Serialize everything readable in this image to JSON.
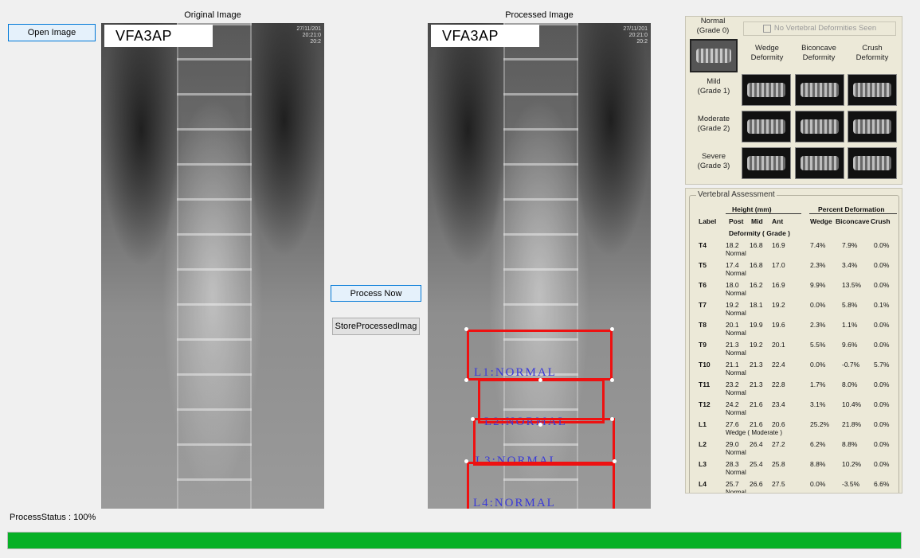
{
  "original": {
    "caption": "Original Image",
    "label": "VFA3AP",
    "stamp": "27/11/201\n20:21:0\n20:2"
  },
  "processed": {
    "caption": "Processed Image",
    "label": "VFA3AP",
    "stamp": "27/11/201\n20:21:0\n20:2",
    "boxes": [
      {
        "label": "L1:NORMAL"
      },
      {
        "label": "L2:NORMAL"
      },
      {
        "label": "L3:NORMAL"
      },
      {
        "label": "L4:NORMAL"
      }
    ]
  },
  "buttons": {
    "open": "Open Image",
    "process": "Process Now",
    "store": "StoreProcessedImag"
  },
  "reference": {
    "normal_label": "Normal\n(Grade 0)",
    "no_deformities": "No Vertebral Deformities Seen",
    "col_wedge": "Wedge\nDeformity",
    "col_biconcave": "Biconcave\nDeformity",
    "col_crush": "Crush\nDeformity",
    "row_mild": "Mild\n(Grade 1)",
    "row_moderate": "Moderate\n(Grade 2)",
    "row_severe": "Severe\n(Grade 3)"
  },
  "assessment": {
    "title": "Vertebral Assessment",
    "height_header": "Height (mm)",
    "percent_header": "Percent Deformation",
    "col_label": "Label",
    "col_post": "Post",
    "col_mid": "Mid",
    "col_ant": "Ant",
    "col_wedge": "Wedge",
    "col_biconcave": "Biconcave",
    "col_crush": "Crush",
    "deformity_header": "Deformity ( Grade )",
    "rows": [
      {
        "label": "T4",
        "post": "18.2",
        "mid": "16.8",
        "ant": "16.9",
        "wedge": "7.4%",
        "biconcave": "7.9%",
        "crush": "0.0%",
        "grade": "Normal"
      },
      {
        "label": "T5",
        "post": "17.4",
        "mid": "16.8",
        "ant": "17.0",
        "wedge": "2.3%",
        "biconcave": "3.4%",
        "crush": "0.0%",
        "grade": "Normal"
      },
      {
        "label": "T6",
        "post": "18.0",
        "mid": "16.2",
        "ant": "16.9",
        "wedge": "9.9%",
        "biconcave": "13.5%",
        "crush": "0.0%",
        "grade": "Normal"
      },
      {
        "label": "T7",
        "post": "19.2",
        "mid": "18.1",
        "ant": "19.2",
        "wedge": "0.0%",
        "biconcave": "5.8%",
        "crush": "0.1%",
        "grade": "Normal"
      },
      {
        "label": "T8",
        "post": "20.1",
        "mid": "19.9",
        "ant": "19.6",
        "wedge": "2.3%",
        "biconcave": "1.1%",
        "crush": "0.0%",
        "grade": "Normal"
      },
      {
        "label": "T9",
        "post": "21.3",
        "mid": "19.2",
        "ant": "20.1",
        "wedge": "5.5%",
        "biconcave": "9.6%",
        "crush": "0.0%",
        "grade": "Normal"
      },
      {
        "label": "T10",
        "post": "21.1",
        "mid": "21.3",
        "ant": "22.4",
        "wedge": "0.0%",
        "biconcave": "-0.7%",
        "crush": "5.7%",
        "grade": "Normal"
      },
      {
        "label": "T11",
        "post": "23.2",
        "mid": "21.3",
        "ant": "22.8",
        "wedge": "1.7%",
        "biconcave": "8.0%",
        "crush": "0.0%",
        "grade": "Normal"
      },
      {
        "label": "T12",
        "post": "24.2",
        "mid": "21.6",
        "ant": "23.4",
        "wedge": "3.1%",
        "biconcave": "10.4%",
        "crush": "0.0%",
        "grade": "Normal"
      },
      {
        "label": "L1",
        "post": "27.6",
        "mid": "21.6",
        "ant": "20.6",
        "wedge": "25.2%",
        "biconcave": "21.8%",
        "crush": "0.0%",
        "grade": "Wedge ( Moderate )"
      },
      {
        "label": "L2",
        "post": "29.0",
        "mid": "26.4",
        "ant": "27.2",
        "wedge": "6.2%",
        "biconcave": "8.8%",
        "crush": "0.0%",
        "grade": "Normal"
      },
      {
        "label": "L3",
        "post": "28.3",
        "mid": "25.4",
        "ant": "25.8",
        "wedge": "8.8%",
        "biconcave": "10.2%",
        "crush": "0.0%",
        "grade": "Normal"
      },
      {
        "label": "L4",
        "post": "25.7",
        "mid": "26.6",
        "ant": "27.5",
        "wedge": "0.0%",
        "biconcave": "-3.5%",
        "crush": "6.6%",
        "grade": "Normal"
      }
    ]
  },
  "status": {
    "text": "ProcessStatus : 100%",
    "progress_percent": 100,
    "progress_color": "#06b025"
  }
}
